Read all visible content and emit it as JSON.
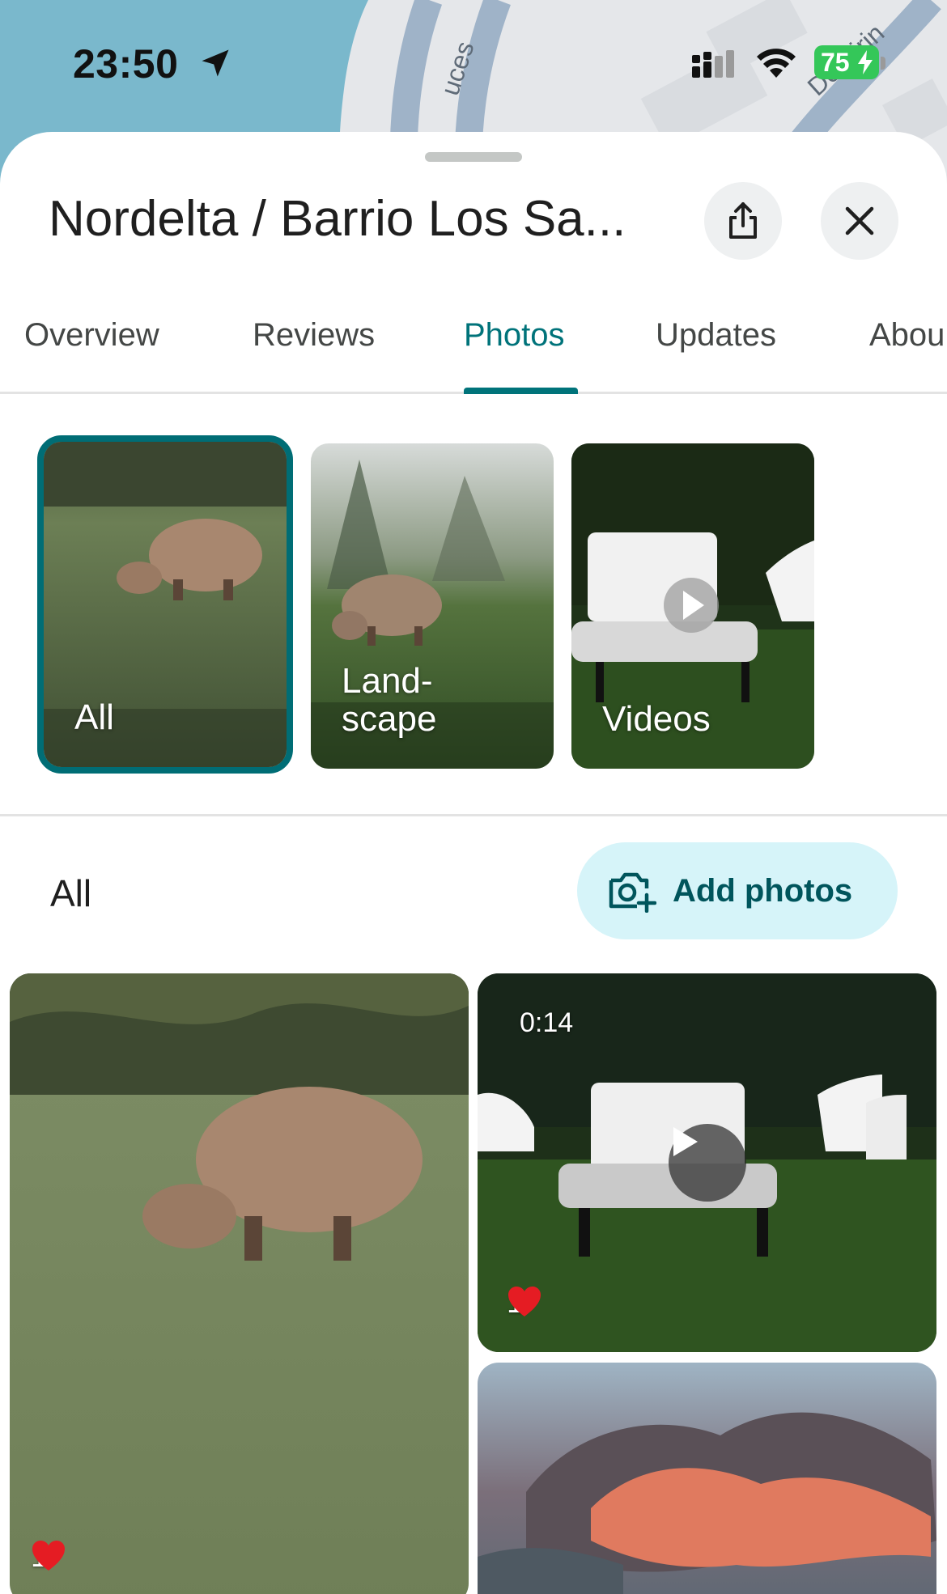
{
  "status_bar": {
    "time": "23:50",
    "battery": "75",
    "icons": [
      "location-arrow-icon",
      "cellular-signal-icon",
      "wifi-icon",
      "battery-charging-icon"
    ]
  },
  "map": {
    "street_labels": [
      "uces",
      "De Pirin"
    ]
  },
  "header": {
    "title": "Nordelta / Barrio Los Sa...",
    "share_icon": "share-icon",
    "close_icon": "close-icon"
  },
  "tabs": [
    {
      "label": "Overview",
      "active": false
    },
    {
      "label": "Reviews",
      "active": false
    },
    {
      "label": "Photos",
      "active": true
    },
    {
      "label": "Updates",
      "active": false
    },
    {
      "label": "Abou",
      "active": false
    }
  ],
  "categories": [
    {
      "label_lines": [
        "All"
      ],
      "selected": true
    },
    {
      "label_lines": [
        "Land-",
        "scape"
      ],
      "selected": false
    },
    {
      "label_lines": [
        "Videos"
      ],
      "selected": false
    }
  ],
  "section": {
    "title": "All",
    "add_photos_label": "Add photos",
    "add_photos_icon": "add-photo-camera-icon"
  },
  "grid": [
    {
      "kind": "photo",
      "subject": "capybara grazing",
      "likes": "1"
    },
    {
      "kind": "video",
      "duration": "0:14",
      "likes": "1"
    },
    {
      "kind": "photo",
      "subject": "sunset clouds"
    }
  ],
  "colors": {
    "accent": "#00737a",
    "add_photos_bg": "#d6f4f9",
    "battery": "#34c759"
  }
}
